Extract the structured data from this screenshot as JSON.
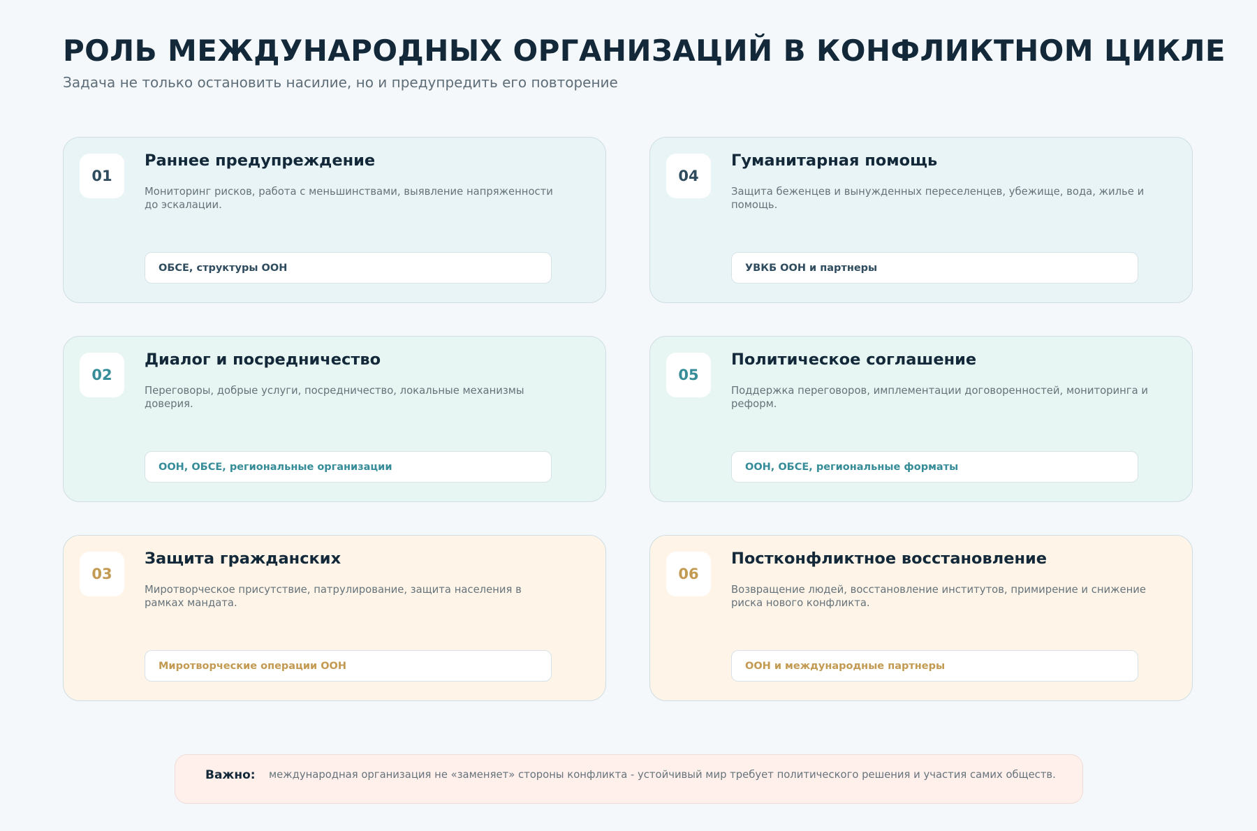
{
  "title": "РОЛЬ МЕЖДУНАРОДНЫХ ОРГАНИЗАЦИЙ В КОНФЛИКТНОМ ЦИКЛЕ",
  "subtitle": "Задача не только остановить насилие, но и предупредить его повторение",
  "colors": {
    "background": "#f4f8fa",
    "heading": "#13293a",
    "blue_accent": "#2f4c5f",
    "green_accent": "#368c98",
    "orange_accent": "#c29a52",
    "blue_card": "#e8f4f5",
    "green_card": "#e7f6f2",
    "orange_card": "#fef4e7",
    "note_background": "#fff0ec"
  },
  "cards": [
    {
      "number": "01",
      "title": "Раннее предупреждение",
      "description": "Мониторинг рисков, работа с меньшинствами, выявление напряженности до эскалации.",
      "organizations": "ОБСЕ, структуры ООН"
    },
    {
      "number": "02",
      "title": "Диалог и посредничество",
      "description": "Переговоры, добрые услуги, посредничество, локальные механизмы доверия.",
      "organizations": "ООН, ОБСЕ, региональные организации"
    },
    {
      "number": "03",
      "title": "Защита гражданских",
      "description": "Миротворческое присутствие, патрулирование, защита населения в рамках мандата.",
      "organizations": "Миротворческие операции ООН"
    },
    {
      "number": "04",
      "title": "Гуманитарная помощь",
      "description": "Защита беженцев и вынужденных переселенцев, убежище, вода, жилье и помощь.",
      "organizations": "УВКБ ООН и партнеры"
    },
    {
      "number": "05",
      "title": "Политическое соглашение",
      "description": "Поддержка переговоров, имплементации договоренностей, мониторинга и реформ.",
      "organizations": "ООН, ОБСЕ, региональные форматы"
    },
    {
      "number": "06",
      "title": "Постконфликтное восстановление",
      "description": "Возвращение людей, восстановление институтов, примирение и снижение риска нового конфликта.",
      "organizations": "ООН и международные партнеры"
    }
  ],
  "note": {
    "label": "Важно:",
    "text": "международная организация не «заменяет» стороны конфликта - устойчивый мир требует политического решения и участия самих обществ."
  }
}
